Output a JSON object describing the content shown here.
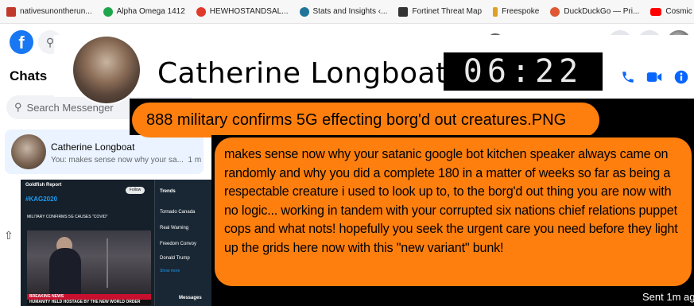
{
  "bookmarks": [
    {
      "label": "nativesunontherun...",
      "color": "#c0392b"
    },
    {
      "label": "Alpha Omega 1412",
      "color": "#1ea64a"
    },
    {
      "label": "HEWHOSTANDSAL...",
      "color": "#e03a2b"
    },
    {
      "label": "Stats and Insights ‹...",
      "color": "#21759b"
    },
    {
      "label": "Fortinet Threat Map",
      "color": "#333333"
    },
    {
      "label": "Freespoke",
      "color": "#e0a020"
    },
    {
      "label": "DuckDuckGo — Pri...",
      "color": "#de5833"
    },
    {
      "label": "Cosmic Agency - Y...",
      "color": "#ff0000"
    }
  ],
  "left_panel": {
    "title": "Chats",
    "search_placeholder": "Search Messenger",
    "chat_item": {
      "name": "Catherine Longboat",
      "preview": "You: makes sense now why your sa...",
      "time": "1 m"
    }
  },
  "conversation": {
    "contact_name": "Catherine Longboat",
    "clock": "06:22",
    "attachment_name": "888 military confirms 5G effecting borg'd out creatures.PNG",
    "message_lines": [
      "makes sense now why your satanic google bot kitchen speaker always came on",
      "randomly and why you did a complete 180 in a matter of weeks so far as being a",
      "respectable creature i used to look up to, to the borg'd out thing you are now with",
      "no logic... working in tandem with your corrupted six nations chief relations puppet",
      "cops and what nots! hopefully you seek the urgent care you need before they light",
      "up the grids here now with this \"new variant\" bunk!"
    ],
    "status": "Sent 1m ag"
  },
  "embedded_screenshot": {
    "header": "Goldfish Report",
    "hashtag": "#KAG2020",
    "follow_label": "Follow",
    "headline": "MILITARY CONFIRMS 5G CAUSES \"COVID\"",
    "breaking": "BREAKING NEWS",
    "ticker": "HUMANITY HELD HOSTAGE BY THE NEW WORLD ORDER",
    "sidebar": [
      "Trends",
      "Tornado Canada",
      "Real Warning",
      "Freedom Convoy",
      "Donald Trump",
      "Show more"
    ],
    "messages_label": "Messages"
  },
  "icons": {
    "call": "phone-icon",
    "video": "video-icon",
    "info": "info-icon"
  }
}
